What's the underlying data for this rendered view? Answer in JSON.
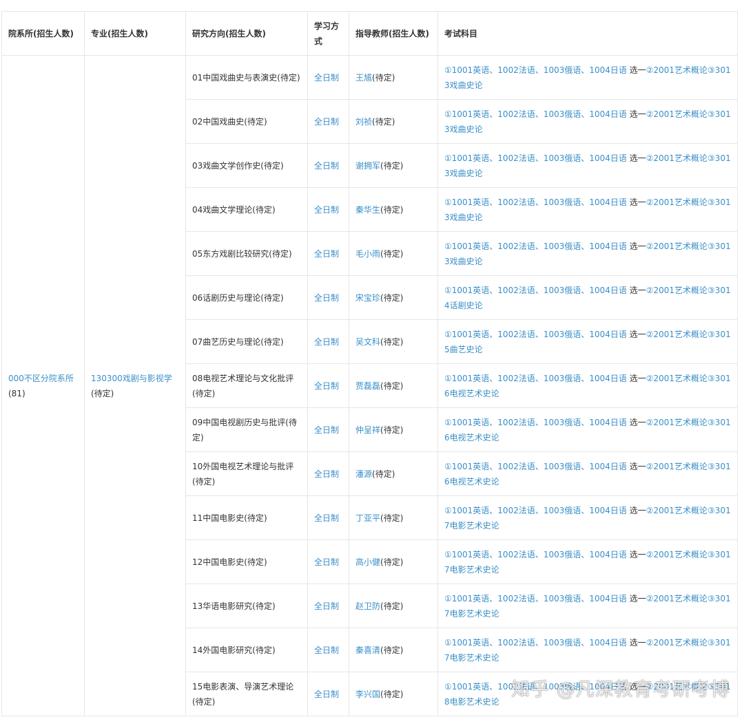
{
  "headers": {
    "dept": "院系所(招生人数)",
    "major": "专业(招生人数)",
    "direction": "研究方向(招生人数)",
    "mode": "学习方式",
    "tutor": "指导教师(招生人数)",
    "exam": "考试科目"
  },
  "dept": {
    "link": "000不区分院系所",
    "count": "(81)"
  },
  "major": {
    "link": "130300戏剧与影视学",
    "count": "(待定)"
  },
  "rows": [
    {
      "direction": "01中国戏曲史与表演史(待定)",
      "mode": "全日制",
      "tutor": "王馗",
      "tutor_count": "(待定)",
      "exam": {
        "a": "①1001英语、1002法语、1003俄语、1004日语",
        "b": " 选一",
        "c": "②2001艺术概论③3013戏曲史论"
      }
    },
    {
      "direction": "02中国戏曲史(待定)",
      "mode": "全日制",
      "tutor": "刘祯",
      "tutor_count": "(待定)",
      "exam": {
        "a": "①1001英语、1002法语、1003俄语、1004日语",
        "b": " 选一",
        "c": "②2001艺术概论③3013戏曲史论"
      }
    },
    {
      "direction": "03戏曲文学创作史(待定)",
      "mode": "全日制",
      "tutor": "谢拥军",
      "tutor_count": "(待定)",
      "exam": {
        "a": "①1001英语、1002法语、1003俄语、1004日语",
        "b": " 选一",
        "c": "②2001艺术概论③3013戏曲史论"
      }
    },
    {
      "direction": "04戏曲文学理论(待定)",
      "mode": "全日制",
      "tutor": "秦华生",
      "tutor_count": "(待定)",
      "exam": {
        "a": "①1001英语、1002法语、1003俄语、1004日语",
        "b": " 选一",
        "c": "②2001艺术概论③3013戏曲史论"
      }
    },
    {
      "direction": "05东方戏剧比较研究(待定)",
      "mode": "全日制",
      "tutor": "毛小雨",
      "tutor_count": "(待定)",
      "exam": {
        "a": "①1001英语、1002法语、1003俄语、1004日语",
        "b": " 选一",
        "c": "②2001艺术概论③3013戏曲史论"
      }
    },
    {
      "direction": "06话剧历史与理论(待定)",
      "mode": "全日制",
      "tutor": "宋宝珍",
      "tutor_count": "(待定)",
      "exam": {
        "a": "①1001英语、1002法语、1003俄语、1004日语",
        "b": " 选一",
        "c": "②2001艺术概论③3014话剧史论"
      }
    },
    {
      "direction": "07曲艺历史与理论(待定)",
      "mode": "全日制",
      "tutor": "吴文科",
      "tutor_count": "(待定)",
      "exam": {
        "a": "①1001英语、1002法语、1003俄语、1004日语",
        "b": " 选一",
        "c": "②2001艺术概论③3015曲艺史论"
      }
    },
    {
      "direction": "08电视艺术理论与文化批评(待定)",
      "mode": "全日制",
      "tutor": "贾磊磊",
      "tutor_count": "(待定)",
      "exam": {
        "a": "①1001英语、1002法语、1003俄语、1004日语",
        "b": " 选一",
        "c": "②2001艺术概论③3016电视艺术史论"
      }
    },
    {
      "direction": "09中国电视剧历史与批评(待定)",
      "mode": "全日制",
      "tutor": "仲呈祥",
      "tutor_count": "(待定)",
      "exam": {
        "a": "①1001英语、1002法语、1003俄语、1004日语",
        "b": " 选一",
        "c": "②2001艺术概论③3016电视艺术史论"
      }
    },
    {
      "direction": "10外国电视艺术理论与批评(待定)",
      "mode": "全日制",
      "tutor": "潘源",
      "tutor_count": "(待定)",
      "exam": {
        "a": "①1001英语、1002法语、1003俄语、1004日语",
        "b": " 选一",
        "c": "②2001艺术概论③3016电视艺术史论"
      }
    },
    {
      "direction": "11中国电影史(待定)",
      "mode": "全日制",
      "tutor": "丁亚平",
      "tutor_count": "(待定)",
      "exam": {
        "a": "①1001英语、1002法语、1003俄语、1004日语",
        "b": " 选一",
        "c": "②2001艺术概论③3017电影艺术史论"
      }
    },
    {
      "direction": "12中国电影史(待定)",
      "mode": "全日制",
      "tutor": "高小健",
      "tutor_count": "(待定)",
      "exam": {
        "a": "①1001英语、1002法语、1003俄语、1004日语",
        "b": " 选一",
        "c": "②2001艺术概论③3017电影艺术史论"
      }
    },
    {
      "direction": "13华语电影研究(待定)",
      "mode": "全日制",
      "tutor": "赵卫防",
      "tutor_count": "(待定)",
      "exam": {
        "a": "①1001英语、1002法语、1003俄语、1004日语",
        "b": " 选一",
        "c": "②2001艺术概论③3017电影艺术史论"
      }
    },
    {
      "direction": "14外国电影研究(待定)",
      "mode": "全日制",
      "tutor": "秦喜清",
      "tutor_count": "(待定)",
      "exam": {
        "a": "①1001英语、1002法语、1003俄语、1004日语",
        "b": " 选一",
        "c": "②2001艺术概论③3017电影艺术史论"
      }
    },
    {
      "direction": "15电影表演、导演艺术理论(待定)",
      "mode": "全日制",
      "tutor": "李兴国",
      "tutor_count": "(待定)",
      "exam": {
        "a": "①1001英语、1002法语、1003俄语、1004日语",
        "b": " 选一",
        "c": "②2001艺术概论③3018电影艺术史论"
      }
    }
  ],
  "watermark": "知乎 @凡深教育考研考博",
  "colors": {
    "link": "#3a8fc8",
    "text": "#333333",
    "border": "#e6e6e6"
  }
}
